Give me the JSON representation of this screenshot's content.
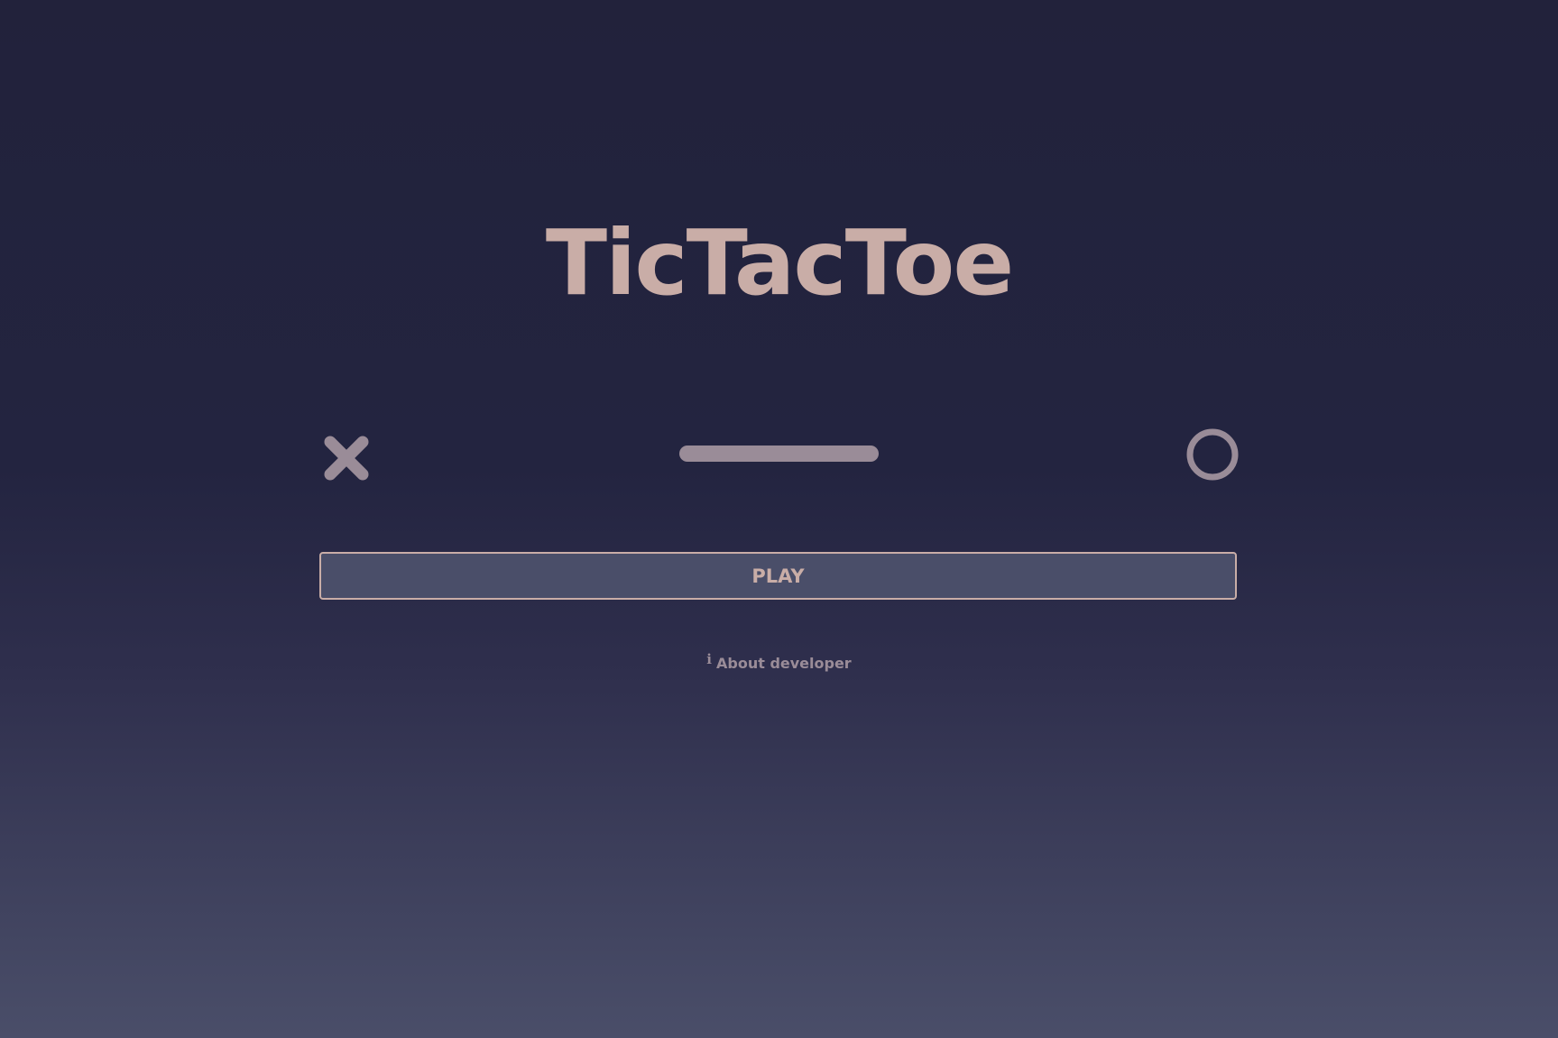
{
  "app": {
    "title": "TicTacToe"
  },
  "players": {
    "x_icon": "x-mark-icon",
    "o_icon": "o-circle-icon"
  },
  "menu": {
    "play_label": "PLAY",
    "about_label": "About developer",
    "about_icon_glyph": "i",
    "about_icon": "info-icon"
  },
  "colors": {
    "background_top": "#22223b",
    "background_bottom": "#4a4e69",
    "title": "#c9ada7",
    "accent_muted": "#9a8c98",
    "button_fill": "#4a4e69",
    "button_border": "#c9ada7"
  }
}
